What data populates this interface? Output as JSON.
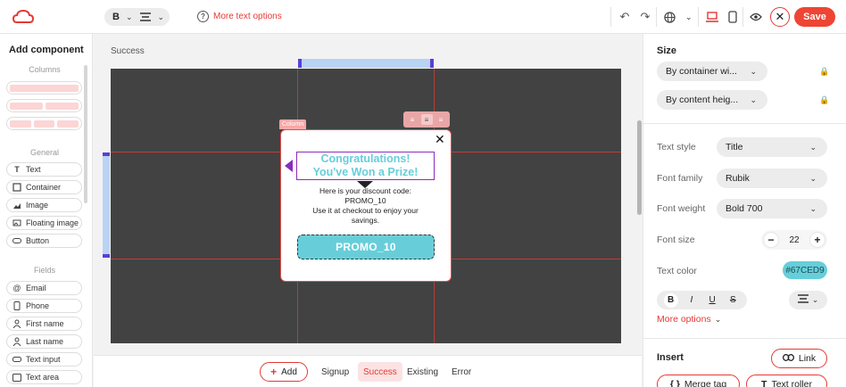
{
  "topbar": {
    "bold_label": "B",
    "more_text_options": "More text options",
    "save_label": "Save"
  },
  "left_panel": {
    "title": "Add component",
    "sections": {
      "columns": "Columns",
      "general": "General",
      "fields": "Fields"
    },
    "general_items": [
      {
        "label": "Text",
        "icon": "text-t-icon"
      },
      {
        "label": "Container",
        "icon": "square-icon"
      },
      {
        "label": "Image",
        "icon": "image-icon"
      },
      {
        "label": "Floating image",
        "icon": "floating-image-icon"
      },
      {
        "label": "Button",
        "icon": "button-pill-icon"
      }
    ],
    "field_items": [
      {
        "label": "Email",
        "icon": "at-icon"
      },
      {
        "label": "Phone",
        "icon": "phone-icon"
      },
      {
        "label": "First name",
        "icon": "person-icon"
      },
      {
        "label": "Last name",
        "icon": "person-icon"
      },
      {
        "label": "Text input",
        "icon": "text-input-icon"
      },
      {
        "label": "Text area",
        "icon": "text-area-icon"
      }
    ]
  },
  "canvas": {
    "breadcrumb": "Success",
    "column_tag": "Column",
    "popup": {
      "headline_line1": "Congratulations!",
      "headline_line2": "You've Won a Prize!",
      "body_line1": "Here is your discount code:",
      "body_line2": "PROMO_10",
      "body_line3": "Use it at checkout to enjoy your",
      "body_line4": "savings.",
      "code_button": "PROMO_10"
    }
  },
  "bottombar": {
    "add_label": "Add",
    "steps": [
      "Signup",
      "Success",
      "Existing",
      "Error"
    ],
    "active_step": "Success"
  },
  "right_panel": {
    "size_title": "Size",
    "width_mode": "By container wi...",
    "height_mode": "By content heig...",
    "text_style_label": "Text style",
    "text_style_value": "Title",
    "font_family_label": "Font family",
    "font_family_value": "Rubik",
    "font_weight_label": "Font weight",
    "font_weight_value": "Bold 700",
    "font_size_label": "Font size",
    "font_size_value": "22",
    "text_color_label": "Text color",
    "text_color_value": "#67CED9",
    "style_buttons": [
      "B",
      "I",
      "U",
      "S"
    ],
    "more_options": "More options",
    "insert_title": "Insert",
    "link_label": "Link",
    "merge_tag_label": "Merge tag",
    "text_roller_label": "Text roller"
  },
  "colors": {
    "accent": "#e53935",
    "headline": "#67CED9",
    "canvas_bg": "#424242",
    "selection": "#8a2bbd"
  }
}
